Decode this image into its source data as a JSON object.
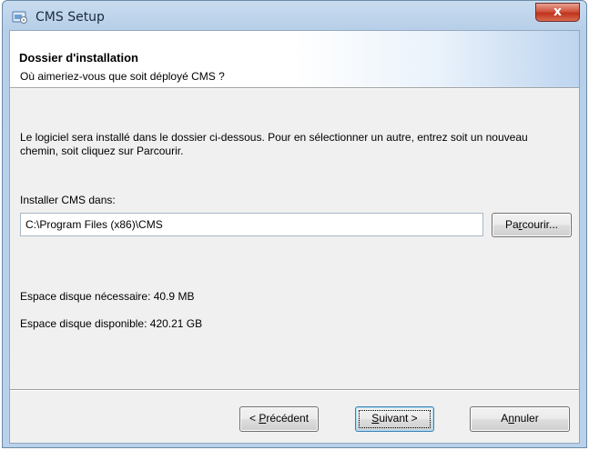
{
  "window": {
    "title": "CMS Setup",
    "close_label": "x"
  },
  "header": {
    "title": "Dossier d'installation",
    "subtitle": "Où aimeriez-vous que soit déployé CMS ?"
  },
  "body": {
    "description": "Le logiciel sera installé dans le dossier ci-dessous. Pour en sélectionner un autre, entrez soit un nouveau chemin, soit cliquez sur Parcourir.",
    "install_label": "Installer CMS dans:",
    "path_value": "C:\\Program Files (x86)\\CMS",
    "browse": {
      "pre": "Pa",
      "accel": "r",
      "post": "courir..."
    },
    "space_required": "Espace disque nécessaire: 40.9 MB",
    "space_available": "Espace disque disponible: 420.21 GB"
  },
  "footer": {
    "prev": {
      "pre": "< ",
      "accel": "P",
      "post": "récédent"
    },
    "next": {
      "pre": "",
      "accel": "S",
      "post": "uivant >"
    },
    "cancel": {
      "pre": "A",
      "accel": "n",
      "post": "nuler"
    }
  },
  "icons": {
    "app": "setup-installer-icon",
    "close": "close-icon"
  },
  "colors": {
    "titlebar": "#b9d1ea",
    "close_button": "#c0321b",
    "dialog_background": "#f0f0f0",
    "default_button_border": "#3c7fb1"
  }
}
